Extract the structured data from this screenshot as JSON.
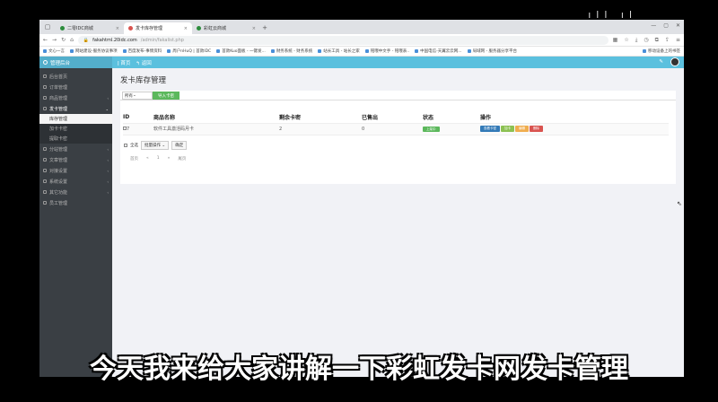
{
  "browser": {
    "tabs": [
      {
        "label": "二零IDC商城",
        "active": false
      },
      {
        "label": "发卡库存管理",
        "active": true
      },
      {
        "label": "彩虹云商城",
        "active": false
      }
    ],
    "url": {
      "prefix": "fakahtml.20idc.com",
      "host": "fakahtml.20idc.com",
      "path": "/admin/fakalist.php"
    },
    "bookmarks": [
      "文心一言",
      "网站建设-服务协议事项",
      "百度发布-事情资料",
      "周户nHuQ | 首款IDC",
      "首款Kuo面板 - 一键发...",
      "财务系统 - 财务系统",
      "站长工具 - 站长之家",
      "铭哦中文手 - 铭哦表..",
      "中国电信-天翼云云网...",
      "局域网 - 服务器分享平台"
    ],
    "bookmark_right": "移动设备上的书签"
  },
  "app": {
    "brand": "管理后台",
    "header_links": [
      "首页",
      "返回"
    ],
    "sidebar": {
      "items": [
        {
          "label": "后台首页",
          "open": false
        },
        {
          "label": "订单管理",
          "open": false
        },
        {
          "label": "商品管理",
          "open": false,
          "chevron": "‹"
        },
        {
          "label": "发卡管理",
          "open": true,
          "chevron": "⌄"
        }
      ],
      "sub_items": [
        {
          "label": "库存管理",
          "active": true
        },
        {
          "label": "加卡卡密",
          "active": false
        },
        {
          "label": "提取卡密",
          "active": false
        }
      ],
      "items_after": [
        {
          "label": "分站管理",
          "chevron": "‹"
        },
        {
          "label": "文章管理",
          "chevron": "‹"
        },
        {
          "label": "对接设置",
          "chevron": "‹"
        },
        {
          "label": "系统设置",
          "chevron": "‹"
        },
        {
          "label": "其它功能",
          "chevron": "‹"
        },
        {
          "label": "员工管理",
          "chevron": ""
        }
      ]
    },
    "page_title": "发卡库存管理",
    "filter_select": "所有",
    "add_button": "导入卡密",
    "table": {
      "headers": [
        "ID",
        "商品名称",
        "剩余卡密",
        "已售出",
        "状态",
        "操作"
      ],
      "rows": [
        {
          "id": "7",
          "name": "软件工具激活码月卡",
          "remaining": "2",
          "sold": "0",
          "status": "上架中",
          "ops": [
            "查看卡密",
            "加卡",
            "编辑",
            "删除"
          ]
        }
      ]
    },
    "batch": {
      "select_all": "全选",
      "action": "批量操作",
      "confirm": "确定"
    },
    "pager": [
      "首页",
      "«",
      "1",
      "»",
      "尾页"
    ]
  },
  "subtitle": "今天我来给大家讲解一下彩虹发卡网发卡管理"
}
